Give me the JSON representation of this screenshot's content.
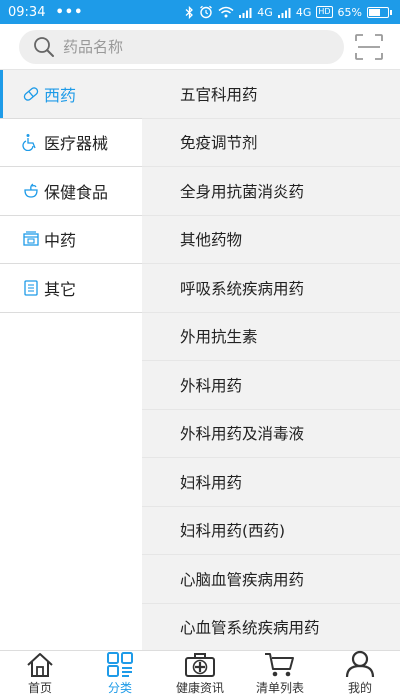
{
  "status_bar": {
    "time": "09:34",
    "dots": "•••",
    "signal1": "4G",
    "signal2": "4G",
    "hd": "HD",
    "battery_percent": "65%",
    "battery_level": 0.65,
    "icons": [
      "bluetooth-icon",
      "alarm-icon",
      "wifi-icon",
      "signal-icon",
      "signal-icon",
      "battery-icon"
    ]
  },
  "search": {
    "placeholder": "药品名称",
    "icon": "search-icon"
  },
  "scan_icon": "scan-icon",
  "sidebar": {
    "items": [
      {
        "label": "西药",
        "icon": "pill-icon",
        "active": true
      },
      {
        "label": "医疗器械",
        "icon": "wheelchair-icon",
        "active": false
      },
      {
        "label": "保健食品",
        "icon": "health-food-icon",
        "active": false
      },
      {
        "label": "中药",
        "icon": "herbal-box-icon",
        "active": false
      },
      {
        "label": "其它",
        "icon": "notepad-icon",
        "active": false
      }
    ]
  },
  "categories": [
    {
      "label": "五官科用药"
    },
    {
      "label": "免疫调节剂"
    },
    {
      "label": "全身用抗菌消炎药"
    },
    {
      "label": "其他药物"
    },
    {
      "label": "呼吸系统疾病用药"
    },
    {
      "label": "外用抗生素"
    },
    {
      "label": "外科用药"
    },
    {
      "label": "外科用药及消毒液"
    },
    {
      "label": "妇科用药"
    },
    {
      "label": "妇科用药(西药)"
    },
    {
      "label": "心脑血管疾病用药"
    },
    {
      "label": "心血管系统疾病用药"
    }
  ],
  "bottom_nav": {
    "items": [
      {
        "label": "首页",
        "icon": "home-icon",
        "active": false
      },
      {
        "label": "分类",
        "icon": "category-grid-icon",
        "active": true
      },
      {
        "label": "健康资讯",
        "icon": "medical-kit-icon",
        "active": false
      },
      {
        "label": "清单列表",
        "icon": "cart-icon",
        "active": false
      },
      {
        "label": "我的",
        "icon": "user-icon",
        "active": false
      }
    ]
  },
  "colors": {
    "accent": "#1e9be8",
    "text": "#222222",
    "list_bg": "#f2f2f2"
  }
}
